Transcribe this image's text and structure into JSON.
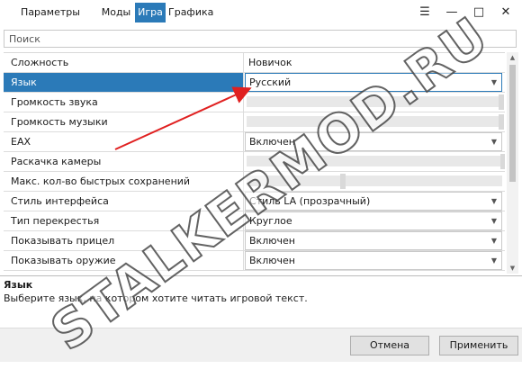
{
  "tabs": [
    {
      "label": "Параметры запуска",
      "active": false
    },
    {
      "label": "Моды",
      "active": false
    },
    {
      "label": "Игра",
      "active": true
    },
    {
      "label": "Графика",
      "active": false
    }
  ],
  "window_buttons": {
    "menu": "☰",
    "minimize": "—",
    "maximize": "□",
    "close": "✕"
  },
  "search": {
    "placeholder": "Поиск"
  },
  "settings": [
    {
      "label": "Сложность",
      "kind": "text",
      "value": "Новичок"
    },
    {
      "label": "Язык",
      "kind": "combo",
      "value": "Русский",
      "selected": true
    },
    {
      "label": "Громкость звука",
      "kind": "slider"
    },
    {
      "label": "Громкость музыки",
      "kind": "slider"
    },
    {
      "label": "EAX",
      "kind": "combo",
      "value": "Включен"
    },
    {
      "label": "Раскачка камеры",
      "kind": "slider"
    },
    {
      "label": "Макс. кол-во быстрых сохранений",
      "kind": "slider"
    },
    {
      "label": "Стиль интерфейса",
      "kind": "combo",
      "value": "Стиль LA (прозрачный)"
    },
    {
      "label": "Тип перекрестья",
      "kind": "combo",
      "value": "Круглое"
    },
    {
      "label": "Показывать прицел",
      "kind": "combo",
      "value": "Включен"
    },
    {
      "label": "Показывать оружие",
      "kind": "combo",
      "value": "Включен"
    }
  ],
  "description": {
    "title": "Язык",
    "text": "Выберите язык, на котором хотите читать игровой текст."
  },
  "buttons": {
    "cancel": "Отмена",
    "apply": "Применить"
  },
  "watermark": "STALKERMOD.RU",
  "colors": {
    "accent": "#2b7ab8",
    "arrow": "#e02020"
  }
}
